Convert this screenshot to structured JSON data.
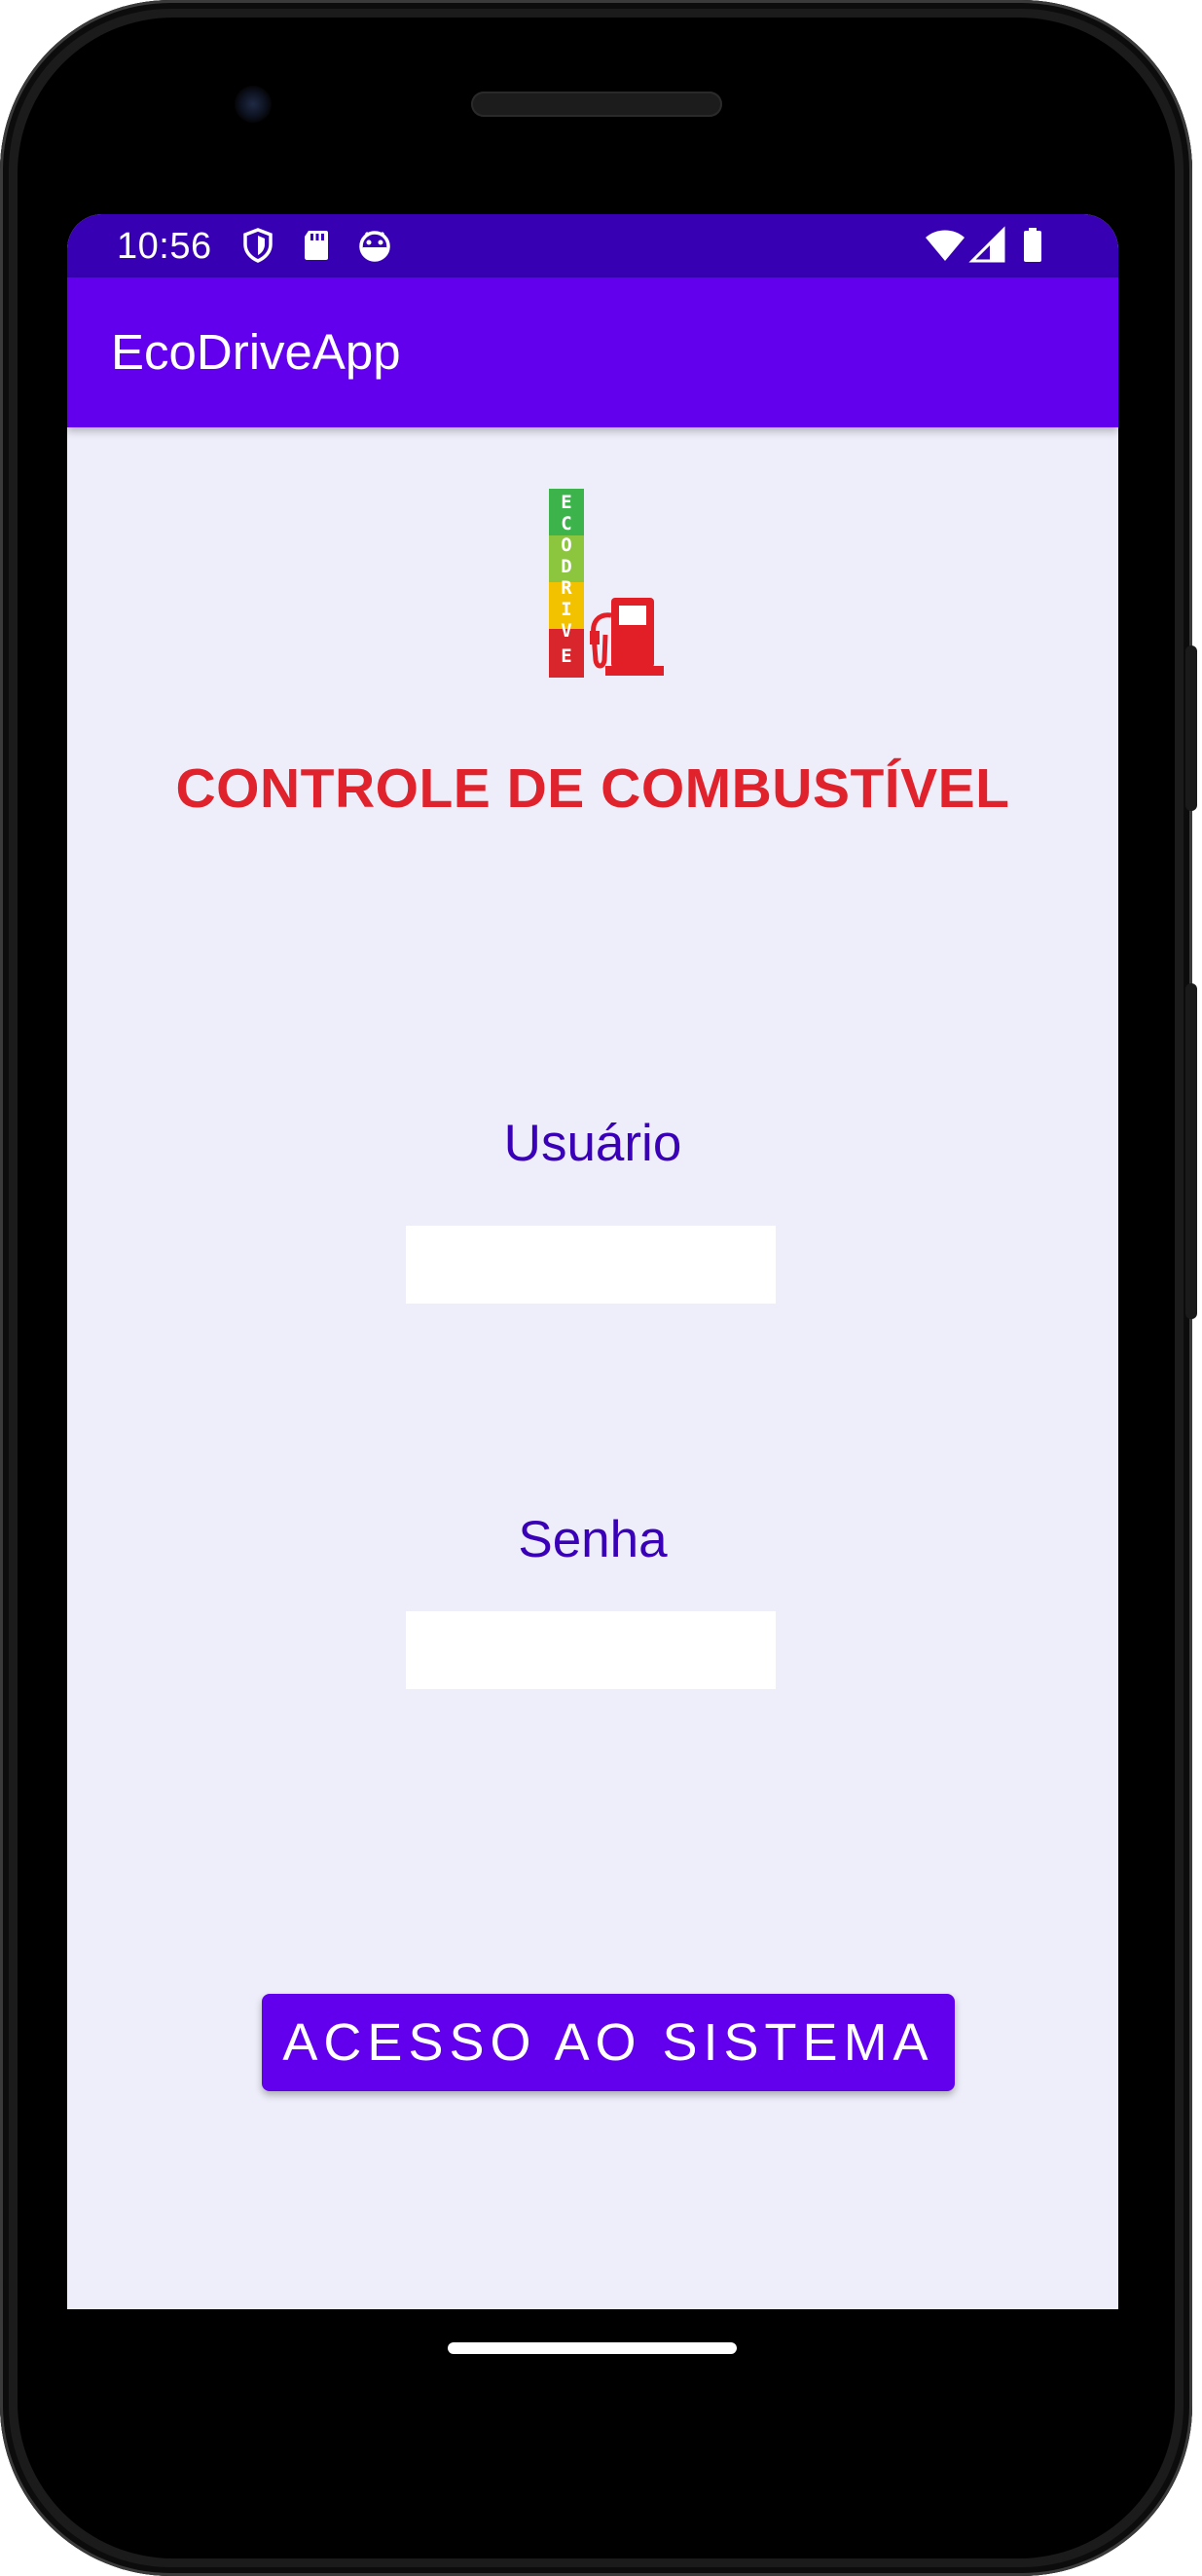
{
  "status_bar": {
    "time": "10:56",
    "left_icons": [
      "shield-icon",
      "sd-card-icon",
      "android-robot-icon"
    ],
    "right_icons": [
      "wifi-icon",
      "cellular-signal-icon",
      "battery-icon"
    ]
  },
  "app_bar": {
    "title": "EcoDriveApp"
  },
  "logo": {
    "icon": "ecodrive-fuel-pump-logo",
    "letters": "ECODRIVE",
    "colors": [
      "#3cb44b",
      "#8cc63f",
      "#f2c200",
      "#d9262c"
    ]
  },
  "headline": "CONTROLE DE COMBUSTÍVEL",
  "form": {
    "username": {
      "label": "Usuário",
      "value": ""
    },
    "password": {
      "label": "Senha",
      "value": ""
    },
    "submit_label": "ACESSO AO SISTEMA"
  },
  "theme": {
    "primary": "#6200ee",
    "primary_dark": "#3700b3",
    "background": "#eeeefa",
    "headline_color": "#e0222c",
    "label_color": "#3a00b8"
  }
}
